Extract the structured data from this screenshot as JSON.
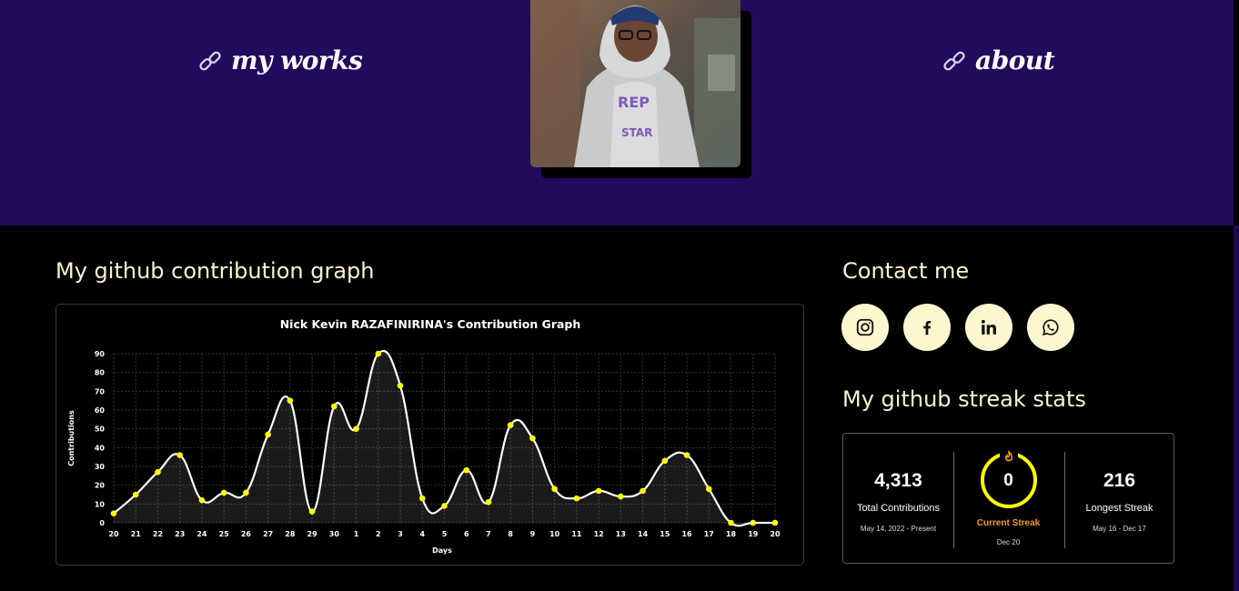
{
  "nav": {
    "works_label": "my works",
    "about_label": "about"
  },
  "profile": {
    "photo_alt": "profile photo"
  },
  "graph_section": {
    "title": "My github contribution graph"
  },
  "contact": {
    "title": "Contact me",
    "links": [
      "instagram-icon",
      "facebook-icon",
      "linkedin-icon",
      "whatsapp-icon"
    ]
  },
  "streak": {
    "title": "My github streak stats",
    "total": {
      "value": "4,313",
      "label": "Total Contributions",
      "range": "May 14, 2022 - Present"
    },
    "current": {
      "value": "0",
      "label": "Current Streak",
      "range": "Dec 20"
    },
    "longest": {
      "value": "216",
      "label": "Longest Streak",
      "range": "May 16 - Dec 17"
    }
  },
  "colors": {
    "hero_bg": "#220a5c",
    "page_bg": "#000000",
    "heading": "#fdf2cf",
    "social_bg": "#fdf7d0",
    "chart_line": "#ffffff",
    "chart_point": "#ffff00",
    "streak_ring": "#ffff00",
    "streak_accent": "#f39c12"
  },
  "chart_data": {
    "type": "line",
    "title": "Nick Kevin RAZAFINIRINA's Contribution Graph",
    "xlabel": "Days",
    "ylabel": "Contributions",
    "categories": [
      "20",
      "21",
      "22",
      "23",
      "24",
      "25",
      "26",
      "27",
      "28",
      "29",
      "30",
      "1",
      "2",
      "3",
      "4",
      "5",
      "6",
      "7",
      "8",
      "9",
      "10",
      "11",
      "12",
      "13",
      "14",
      "15",
      "16",
      "17",
      "18",
      "19",
      "20"
    ],
    "values": [
      5,
      15,
      27,
      36,
      12,
      16,
      16,
      47,
      65,
      6,
      62,
      50,
      90,
      73,
      13,
      9,
      28,
      11,
      52,
      45,
      18,
      13,
      17,
      14,
      17,
      33,
      36,
      18,
      0,
      0,
      0
    ],
    "ylim": [
      0,
      90
    ],
    "yticks": [
      0,
      10,
      20,
      30,
      40,
      50,
      60,
      70,
      80,
      90
    ],
    "grid": true,
    "legend": "none"
  }
}
